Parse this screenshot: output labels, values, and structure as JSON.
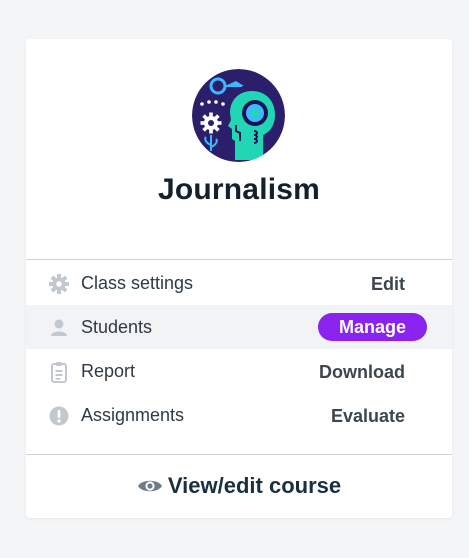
{
  "course": {
    "title": "Journalism"
  },
  "menu": [
    {
      "icon": "gear-icon",
      "label": "Class settings",
      "action": "Edit"
    },
    {
      "icon": "person-icon",
      "label": "Students",
      "action": "Manage"
    },
    {
      "icon": "clipboard-icon",
      "label": "Report",
      "action": "Download"
    },
    {
      "icon": "alert-icon",
      "label": "Assignments",
      "action": "Evaluate"
    }
  ],
  "footer": {
    "icon": "eye-icon",
    "label": "View/edit course"
  },
  "colors": {
    "accent": "#8a22f0",
    "title": "#13202d",
    "art_background": "#2b1f6b",
    "art_teal": "#21d6b4"
  }
}
